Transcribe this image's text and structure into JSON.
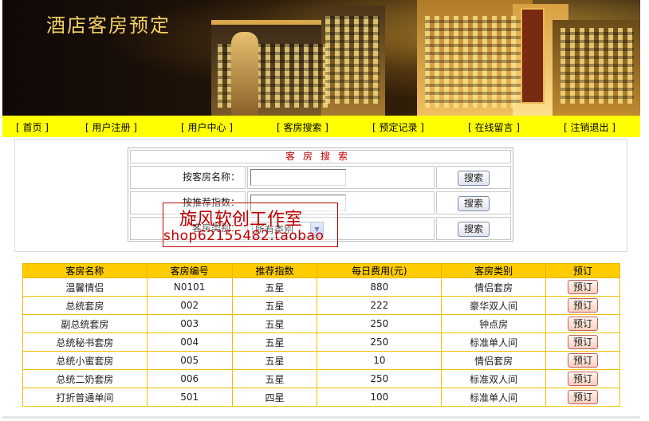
{
  "banner": {
    "title": "酒店客房预定"
  },
  "nav": {
    "items": [
      {
        "label": "[ 首页 ]"
      },
      {
        "label": "[ 用户注册 ]"
      },
      {
        "label": "[ 用户中心 ]"
      },
      {
        "label": "[ 客房搜索 ]"
      },
      {
        "label": "[ 预定记录 ]"
      },
      {
        "label": "[ 在线留言 ]"
      },
      {
        "label": "[ 注销退出 ]"
      }
    ]
  },
  "search": {
    "title": "客房搜索",
    "by_name_label": "按客房名称：",
    "by_name_value": "",
    "by_rating_label": "按推荐指数：",
    "by_rating_value": "",
    "by_type_label": "客房类别：",
    "type_selected": "所有类别",
    "button": "搜索"
  },
  "watermark": {
    "line1": "旋风软创工作室",
    "line2": "shop62155482.taobao"
  },
  "table": {
    "headers": [
      "客房名称",
      "客房编号",
      "推荐指数",
      "每日费用(元)",
      "客房类别",
      "预订"
    ],
    "book_label": "预订",
    "rows": [
      {
        "name": "温馨情侣",
        "code": "N0101",
        "rating": "五星",
        "price": "880",
        "type": "情侣套房"
      },
      {
        "name": "总统套房",
        "code": "002",
        "rating": "五星",
        "price": "222",
        "type": "豪华双人间"
      },
      {
        "name": "副总统套房",
        "code": "003",
        "rating": "五星",
        "price": "250",
        "type": "钟点房"
      },
      {
        "name": "总统秘书套房",
        "code": "004",
        "rating": "五星",
        "price": "250",
        "type": "标准单人间"
      },
      {
        "name": "总统小蜜套房",
        "code": "005",
        "rating": "五星",
        "price": "10",
        "type": "情侣套房"
      },
      {
        "name": "总统二奶套房",
        "code": "006",
        "rating": "五星",
        "price": "250",
        "type": "标准双人间"
      },
      {
        "name": "打折普通单间",
        "code": "501",
        "rating": "四星",
        "price": "100",
        "type": "标准单人间"
      }
    ]
  }
}
